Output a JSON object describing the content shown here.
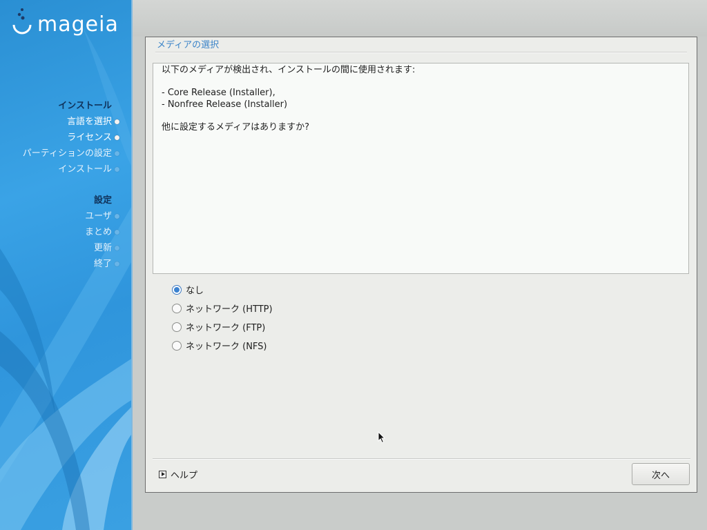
{
  "brand": {
    "logo_text": "mageia"
  },
  "sidebar": {
    "sections": [
      {
        "heading": "インストール",
        "items": [
          {
            "label": "言語を選択",
            "state": "done"
          },
          {
            "label": "ライセンス",
            "state": "done"
          },
          {
            "label": "パーティションの設定",
            "state": "todo"
          },
          {
            "label": "インストール",
            "state": "todo"
          }
        ]
      },
      {
        "heading": "設定",
        "items": [
          {
            "label": "ユーザ",
            "state": "todo"
          },
          {
            "label": "まとめ",
            "state": "todo"
          },
          {
            "label": "更新",
            "state": "todo"
          },
          {
            "label": "終了",
            "state": "todo"
          }
        ]
      }
    ]
  },
  "dialog": {
    "title": "メディアの選択",
    "message": {
      "intro": "以下のメディアが検出され、インストールの間に使用されます:",
      "media": [
        "- Core Release (Installer),",
        "- Nonfree Release (Installer)"
      ],
      "question": "他に設定するメディアはありますか?"
    },
    "options": [
      {
        "label": "なし",
        "selected": true
      },
      {
        "label": "ネットワーク (HTTP)",
        "selected": false
      },
      {
        "label": "ネットワーク (FTP)",
        "selected": false
      },
      {
        "label": "ネットワーク (NFS)",
        "selected": false
      }
    ],
    "help_label": "ヘルプ",
    "next_label": "次へ"
  },
  "colors": {
    "accent": "#3b84c8",
    "sidebar": "#2f95dc",
    "heading": "#10325a"
  }
}
